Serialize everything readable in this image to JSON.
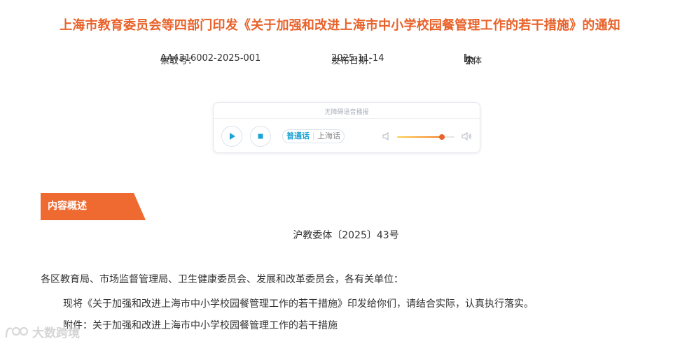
{
  "page": {
    "title": "上海市教育委员会等四部门印发《关于加强和改进上海市中小学校园餐管理工作的若干措施》的通知"
  },
  "meta": {
    "index_label": "索取号：",
    "index_value": "AA4316002-2025-001",
    "date_label": "发布日期：",
    "date_value": "2025-11-14",
    "font_label": "字体",
    "font_open": "[",
    "font_large": "大",
    "font_medium": "中",
    "font_small": "小",
    "font_close": "]"
  },
  "player": {
    "title": "无障碍语音播报",
    "lang_mandarin": "普通话",
    "lang_shanghai": "上海话",
    "volume_level": 0.78,
    "accent": "#e8622a",
    "play_color": "#1aa3d6"
  },
  "section": {
    "tab_label": "内容概述",
    "tab_color": "#ef6a30"
  },
  "content": {
    "doc_number": "沪教委体〔2025〕43号",
    "addressee": "各区教育局、市场监督管理局、卫生健康委员会、发展和改革委员会，各有关单位：",
    "body": "现将《关于加强和改进上海市中小学校园餐管理工作的若干措施》印发给你们，请结合实际，认真执行落实。",
    "attachment": "附件：关于加强和改进上海市中小学校园餐管理工作的若干措施"
  },
  "watermark": {
    "text": "大数跨境"
  }
}
